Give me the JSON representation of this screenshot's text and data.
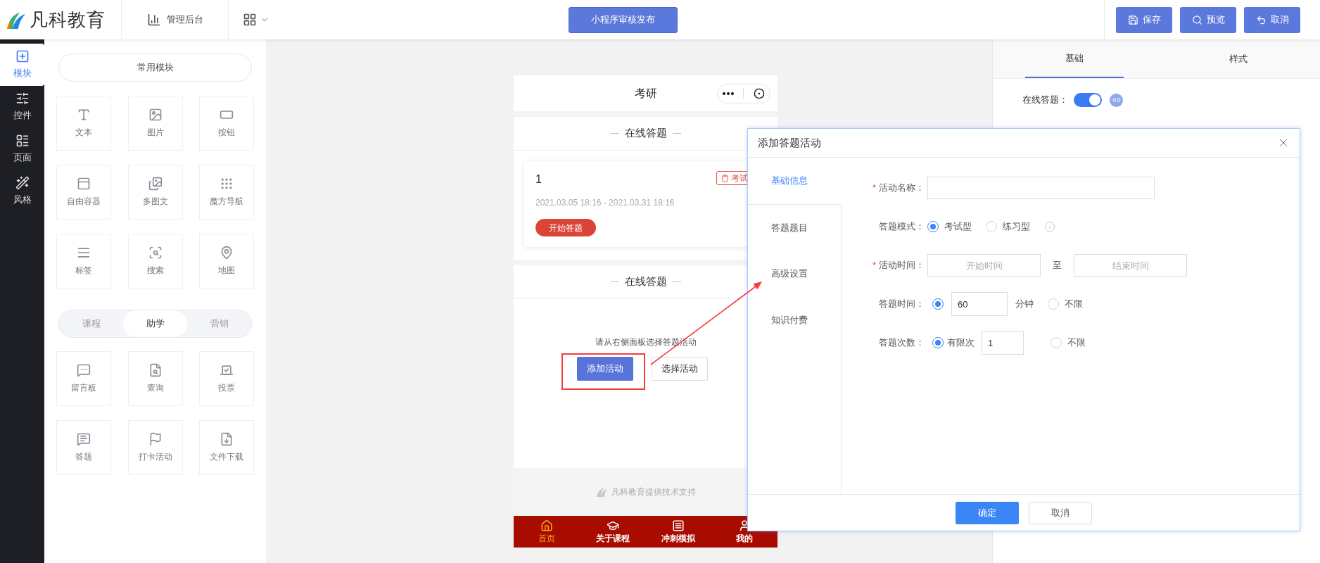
{
  "header": {
    "logo": "凡科教育",
    "admin_link": "管理后台",
    "publish_button": "小程序审核发布",
    "actions": [
      {
        "label": "保存"
      },
      {
        "label": "预览"
      },
      {
        "label": "取消"
      }
    ]
  },
  "sidebar": {
    "items": [
      {
        "label": "模块",
        "selected": true
      },
      {
        "label": "控件",
        "selected": false
      },
      {
        "label": "页面",
        "selected": false
      },
      {
        "label": "风格",
        "selected": false
      }
    ]
  },
  "modules": {
    "common_title": "常用模块",
    "common": [
      "文本",
      "图片",
      "按钮",
      "自由容器",
      "多图文",
      "魔方导航",
      "标签",
      "搜索",
      "地图"
    ],
    "tabs": [
      {
        "label": "课程",
        "selected": false
      },
      {
        "label": "助学",
        "selected": true
      },
      {
        "label": "营销",
        "selected": false
      }
    ],
    "items": [
      "留言板",
      "查询",
      "投票",
      "答题",
      "打卡活动",
      "文件下载"
    ]
  },
  "phone": {
    "title": "考研",
    "sections": [
      {
        "kind": "activity",
        "title": "在线答题",
        "card": {
          "title": "1",
          "badge": "考试",
          "dates": "2021.03.05 18:16 - 2021.03.31 18:16",
          "button": "开始答题"
        }
      },
      {
        "kind": "empty",
        "title": "在线答题",
        "hint": "请从右侧面板选择答题活动",
        "buttons": [
          "添加活动",
          "选择活动"
        ]
      }
    ],
    "footer": "凡科教育提供技术支持",
    "nav": [
      {
        "label": "首页",
        "selected": true
      },
      {
        "label": "关于课程",
        "selected": false
      },
      {
        "label": "冲刺模拟",
        "selected": false
      },
      {
        "label": "我的",
        "selected": false
      }
    ]
  },
  "dialog": {
    "title": "添加答题活动",
    "tabs": [
      {
        "label": "基础信息",
        "selected": true
      },
      {
        "label": "答题题目",
        "selected": false
      },
      {
        "label": "高级设置",
        "selected": false
      },
      {
        "label": "知识付费",
        "selected": false
      }
    ],
    "rows": [
      {
        "kind": "text",
        "label": "活动名称：",
        "required_mark": "*"
      },
      {
        "kind": "choice",
        "label": "答题模式：",
        "options": [
          {
            "label": "考试型",
            "selected": true
          },
          {
            "label": "练习型",
            "selected": false
          }
        ]
      },
      {
        "kind": "range",
        "label": "活动时间：",
        "required_mark": "*",
        "start_placeholder": "开始时间",
        "separator": "至",
        "end_placeholder": "结束时间"
      },
      {
        "kind": "limit",
        "label": "答题时间：",
        "limited": {
          "selected": true,
          "value": "60",
          "unit": "分钟"
        },
        "unlimited": {
          "selected": false,
          "label": "不限"
        }
      },
      {
        "kind": "limit",
        "label": "答题次数：",
        "limited": {
          "selected": true,
          "prefix": "有限次",
          "value": "1"
        },
        "unlimited": {
          "selected": false,
          "label": "不限"
        }
      }
    ],
    "buttons": [
      {
        "label": "确定",
        "kind": "primary"
      },
      {
        "label": "取消",
        "kind": "default"
      }
    ]
  },
  "settings": {
    "tabs": [
      {
        "label": "基础",
        "selected": true
      },
      {
        "label": "样式",
        "selected": false
      }
    ],
    "online": {
      "label": "在线答题：",
      "on": true
    }
  }
}
